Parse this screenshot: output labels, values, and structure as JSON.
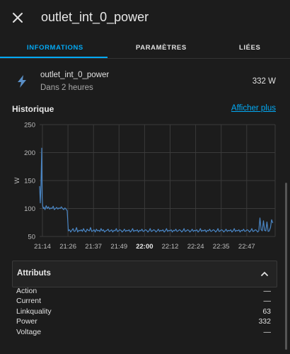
{
  "header": {
    "title": "outlet_int_0_power"
  },
  "tabs": [
    {
      "label": "INFORMATIONS",
      "active": true
    },
    {
      "label": "PARAMÈTRES",
      "active": false
    },
    {
      "label": "LIÉES",
      "active": false
    }
  ],
  "entity": {
    "name": "outlet_int_0_power",
    "subtitle": "Dans 2 heures",
    "value": "332 W",
    "icon": "lightning-bolt-icon"
  },
  "history": {
    "title": "Historique",
    "more_link": "Afficher plus"
  },
  "chart_data": {
    "type": "line",
    "ylabel": "W",
    "xlabel": "",
    "ylim": [
      50,
      250
    ],
    "yticks": [
      50,
      100,
      150,
      200,
      250
    ],
    "xticks": [
      "21:14",
      "21:26",
      "21:37",
      "21:49",
      "22:00",
      "22:12",
      "22:24",
      "22:35",
      "22:47"
    ],
    "bold_tick": "22:00",
    "grid": true,
    "series": [
      {
        "color": "#4a86c5",
        "x_minutes": [
          0,
          0.3,
          0.6,
          0.9,
          1.1,
          1.3,
          1.6,
          1.9,
          2.3,
          2.8,
          3.3,
          3.8,
          4.3,
          4.8,
          5.3,
          5.8,
          6.3,
          6.8,
          7.3,
          7.8,
          8.3,
          8.8,
          9.3,
          9.8,
          10.3,
          10.8,
          11.3,
          11.8,
          12.3,
          12.8,
          13.3,
          13.8,
          14.3,
          14.8,
          15.3,
          15.8,
          16.3,
          16.8,
          17.3,
          17.8,
          18.3,
          18.8,
          19.3,
          19.8,
          20.3,
          20.8,
          21.3,
          21.8,
          22.3,
          22.8,
          23.3,
          23.8,
          24.3,
          24.8,
          25.3,
          25.8,
          26.3,
          26.8,
          27.3,
          27.8,
          28.3,
          28.8,
          29.3,
          29.8,
          30.3,
          30.8,
          31.3,
          31.8,
          32.3,
          32.8,
          33.3,
          33.8,
          34.3,
          34.8,
          35.3,
          35.8,
          36.3,
          36.8,
          37.3,
          37.8,
          38.3,
          38.8,
          39.3,
          39.8,
          40.3,
          40.8,
          41.3,
          41.8,
          42.3,
          42.8,
          43.3,
          43.8,
          44.3,
          44.8,
          45.3,
          45.8,
          46.3,
          46.8,
          47.3,
          47.8,
          48.3,
          48.8,
          49.3,
          49.8,
          50.3,
          50.8,
          51.3,
          51.8,
          52.3,
          52.8,
          53.3,
          53.8,
          54.3,
          54.8,
          55.3,
          55.8,
          56.3,
          56.8,
          57.3,
          57.8,
          58.3,
          58.8,
          59.3,
          59.8,
          60.3,
          60.8,
          61.3,
          61.8,
          62.3,
          62.8,
          63.3,
          63.8,
          64.3,
          64.8,
          65.3,
          65.8,
          66.3,
          66.8,
          67.3,
          67.8,
          68.3,
          68.8,
          69.3,
          69.8,
          70.3,
          70.8,
          71.3,
          71.8,
          72.3,
          72.8,
          73.3,
          73.8,
          74.3,
          74.8,
          75.3,
          75.8,
          76.3,
          76.8,
          77.3,
          77.8,
          78.3,
          78.8,
          79.3,
          79.8,
          80.3,
          80.8,
          81.3,
          81.8,
          82.3,
          82.8,
          83.3,
          83.8,
          84.3,
          84.8,
          85.3,
          85.8,
          86.3,
          86.8,
          87.3,
          87.8,
          88.3,
          88.8,
          89.3,
          89.8,
          90.3,
          90.8,
          91.3,
          91.8,
          92.3,
          92.8,
          93.3,
          93.8,
          94.3,
          94.8,
          95.3,
          95.8,
          96.3,
          96.8,
          97.3,
          97.8,
          98.3,
          98.8,
          99.3,
          99.8,
          100.3,
          100.8
        ],
        "values": [
          140,
          110,
          145,
          208,
          120,
          105,
          100,
          102,
          98,
          105,
          100,
          103,
          99,
          101,
          100,
          104,
          98,
          100,
          102,
          99,
          101,
          100,
          103,
          100,
          98,
          101,
          99,
          96,
          60,
          62,
          58,
          61,
          64,
          59,
          60,
          66,
          58,
          61,
          60,
          62,
          59,
          64,
          60,
          58,
          63,
          61,
          60,
          66,
          59,
          60,
          62,
          58,
          63,
          60,
          61,
          59,
          64,
          60,
          62,
          58,
          60,
          61,
          63,
          59,
          60,
          62,
          58,
          61,
          60,
          64,
          59,
          60,
          62,
          61,
          58,
          60,
          63,
          59,
          61,
          60,
          62,
          58,
          60,
          64,
          59,
          61,
          60,
          62,
          58,
          61,
          60,
          63,
          59,
          60,
          62,
          61,
          58,
          60,
          64,
          59,
          60,
          62,
          61,
          58,
          60,
          63,
          59,
          61,
          60,
          62,
          58,
          60,
          64,
          59,
          61,
          60,
          62,
          58,
          61,
          60,
          63,
          59,
          60,
          62,
          61,
          58,
          60,
          64,
          59,
          60,
          62,
          61,
          58,
          60,
          63,
          59,
          61,
          60,
          62,
          58,
          60,
          64,
          59,
          61,
          60,
          62,
          58,
          61,
          60,
          63,
          59,
          60,
          62,
          61,
          58,
          60,
          64,
          59,
          60,
          62,
          61,
          58,
          60,
          63,
          59,
          61,
          60,
          62,
          58,
          60,
          64,
          59,
          61,
          60,
          62,
          58,
          61,
          60,
          63,
          59,
          60,
          62,
          61,
          58,
          60,
          64,
          59,
          60,
          62,
          61,
          58,
          60,
          83,
          62,
          60,
          78,
          61,
          60,
          76,
          59,
          60,
          66,
          80,
          74
        ]
      }
    ]
  },
  "attributes": {
    "title": "Attributs",
    "rows": [
      {
        "key": "Action",
        "value": "—"
      },
      {
        "key": "Current",
        "value": "—"
      },
      {
        "key": "Linkquality",
        "value": "63"
      },
      {
        "key": "Power",
        "value": "332"
      },
      {
        "key": "Voltage",
        "value": "—"
      }
    ]
  },
  "colors": {
    "accent": "#03a9f4",
    "background": "#1c1c1c",
    "series": "#4a86c5"
  }
}
